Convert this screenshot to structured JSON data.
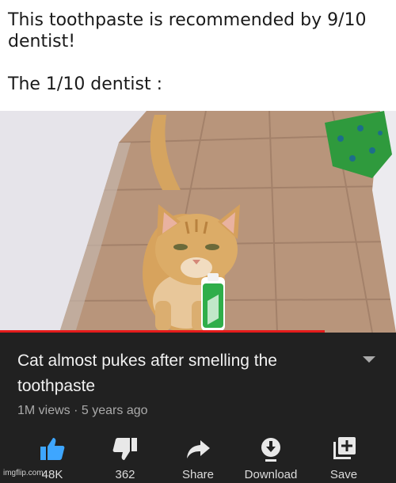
{
  "meme": {
    "line1": "This toothpaste is recommended by 9/10",
    "line2": "dentist!",
    "line3": "The 1/10 dentist :"
  },
  "video": {
    "title_line1": "Cat almost pukes after smelling the",
    "title_line2": "toothpaste",
    "meta": "1M views · 5 years ago",
    "progress_fraction": 0.82
  },
  "actions": [
    {
      "icon": "like-icon",
      "label": "48K"
    },
    {
      "icon": "dislike-icon",
      "label": "362"
    },
    {
      "icon": "share-icon",
      "label": "Share"
    },
    {
      "icon": "download-icon",
      "label": "Download"
    },
    {
      "icon": "save-icon",
      "label": "Save"
    }
  ],
  "watermark": "imgflip.com",
  "colors": {
    "panel_bg": "#212121",
    "progress_red": "#e41b1b",
    "like_blue": "#3ea6ff",
    "text_gray": "#aaaaaa"
  }
}
